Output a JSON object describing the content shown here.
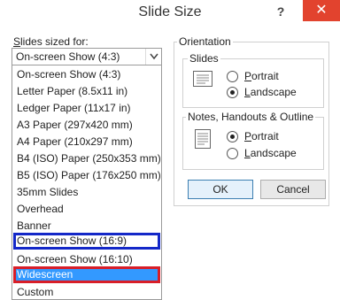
{
  "dialog": {
    "title": "Slide Size",
    "help": "?",
    "close": "✕"
  },
  "slides_sized_for": {
    "label_underlined": "S",
    "label_rest": "lides sized for:",
    "value": "On-screen Show (4:3)",
    "options": [
      "On-screen Show (4:3)",
      "Letter Paper (8.5x11 in)",
      "Ledger Paper (11x17 in)",
      "A3 Paper (297x420 mm)",
      "A4 Paper (210x297 mm)",
      "B4 (ISO) Paper (250x353 mm)",
      "B5 (ISO) Paper (176x250 mm)",
      "35mm Slides",
      "Overhead",
      "Banner",
      "On-screen Show (16:9)",
      "On-screen Show (16:10)",
      "Widescreen",
      "Custom"
    ],
    "selected_option": "Widescreen"
  },
  "orientation": {
    "label": "Orientation",
    "slides": {
      "label": "Slides",
      "portrait_underlined": "P",
      "portrait_rest": "ortrait",
      "landscape_underlined": "L",
      "landscape_rest": "andscape",
      "selected": "Landscape"
    },
    "notes": {
      "label": "Notes, Handouts & Outline",
      "portrait_underlined": "P",
      "portrait_rest": "ortrait",
      "landscape_underlined": "L",
      "landscape_rest": "andscape",
      "selected": "Portrait"
    }
  },
  "buttons": {
    "ok": "OK",
    "cancel": "Cancel"
  },
  "colors": {
    "selection": "#3399ff",
    "highlight_blue": "#1428c8",
    "highlight_red": "#d81e28",
    "close_button": "#e2432e"
  }
}
